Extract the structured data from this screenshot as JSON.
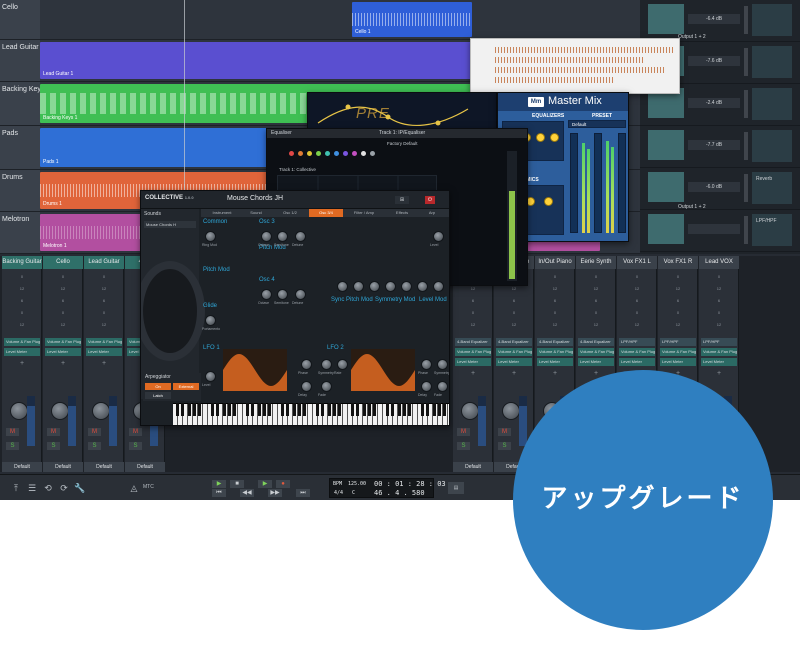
{
  "arrangement": {
    "tracks": [
      {
        "name": "Cello",
        "clip_label": "Cello 1",
        "color": "#2f5fd8"
      },
      {
        "name": "Lead Guitar",
        "clip_label": "Lead Guitar 1",
        "color": "#5a4fd0"
      },
      {
        "name": "Backing Keys",
        "clip_label": "Backing Keys 1",
        "color": "#3fbf54"
      },
      {
        "name": "Pads",
        "clip_label": "Pads 1",
        "color": "#2f6fd6"
      },
      {
        "name": "Drums",
        "clip_label": "Drums 1",
        "color": "#e0643a"
      },
      {
        "name": "Melotron",
        "clip_label": "Melotron 1",
        "color": "#b24fa0"
      }
    ]
  },
  "inspector": {
    "rows": [
      {
        "db": "-6.4 dB",
        "output": "Output 1 + 2"
      },
      {
        "db": "-7.6 dB",
        "output": ""
      },
      {
        "db": "-2.4 dB",
        "output": ""
      },
      {
        "db": "-7.7 dB",
        "output": ""
      },
      {
        "db": "-6.0 dB",
        "output": "Output 1 + 2",
        "fx": "Reverb"
      },
      {
        "db": "",
        "output": "",
        "fx": "LPF/HPF"
      }
    ]
  },
  "mixer": {
    "strips_left": [
      "Backing Guitar",
      "Cello",
      "Lead Guitar",
      "4-Ba"
    ],
    "strips_right": [
      "ngs",
      "Lead Piano",
      "In/Out Piano",
      "Eerie Synth",
      "Vox FX1 L",
      "Vox FX1 R",
      "Lead VOX"
    ],
    "scale": [
      "0",
      "12",
      "6",
      "0",
      "12"
    ],
    "slot_volume_pan": "Volume & Fan Plugin",
    "slot_level_meter": "Level Meter",
    "slot_equalizer": "4-Band Equalizer",
    "slot_reverb": "Reverb",
    "slot_lpf": "LPF/HPF",
    "footer": "Default",
    "mute": "M",
    "solo": "S"
  },
  "transport": {
    "bpm_label": "BPM",
    "bpm": "125.00",
    "time": "00 : 01 : 28 : 03",
    "signature": "4/4",
    "key": "C",
    "bars": "46 . 4 . 580",
    "mtc": "MTC"
  },
  "master_mix": {
    "logo": "Mm",
    "title": "Master Mix",
    "equalizers": "EQUALIZERS",
    "preset": "PRESET",
    "preset_value": "Default",
    "dynamics": "DYNAMICS",
    "accent": "#ffd23a"
  },
  "para_eq": {
    "text": "PRE"
  },
  "equaliser": {
    "title": "Equaliser",
    "track": "Track 1: IP/Equaliser",
    "preset": "Factory Default",
    "footer": "Track 1: Collective"
  },
  "collective": {
    "logo": "COLLECTIVE",
    "version": "1.0.0",
    "preset": "Mouse Chords JH",
    "sounds_label": "Sounds",
    "sounds_field": "Mouse Chords H",
    "tabs": [
      "Instrument",
      "Sound",
      "Osc 1/2",
      "Osc 3/4",
      "Filter / Amp",
      "Effects",
      "Arp"
    ],
    "sections": {
      "common": "Common",
      "osc3": "Osc 3",
      "pitch_mod": "Pitch Mod",
      "pitch_mod2": "Pitch Mod",
      "osc4": "Osc 4",
      "sync_pitch": "Sync Pitch Mod",
      "symmetry_mod": "Symmetry Mod",
      "level_mod": "Level Mod",
      "glide": "Glide",
      "lfo1": "LFO 1",
      "lfo2": "LFO 2",
      "arpeggiator": "Arpeggiator"
    },
    "labels": {
      "ring_mod": "Ring Mod",
      "octave": "Octave",
      "semitone": "Semitone",
      "detune": "Detune",
      "phase": "Phase",
      "symmetry": "Symmetry",
      "rate": "Rate",
      "delay": "Delay",
      "fade": "Fade",
      "level": "Level",
      "legato": "Legato",
      "portamento": "Portamento",
      "on": "On",
      "external": "External",
      "latch": "Latch"
    },
    "accent": "#e06a22"
  },
  "badge": {
    "text": "アップグレード",
    "color": "#2f7fc0"
  }
}
